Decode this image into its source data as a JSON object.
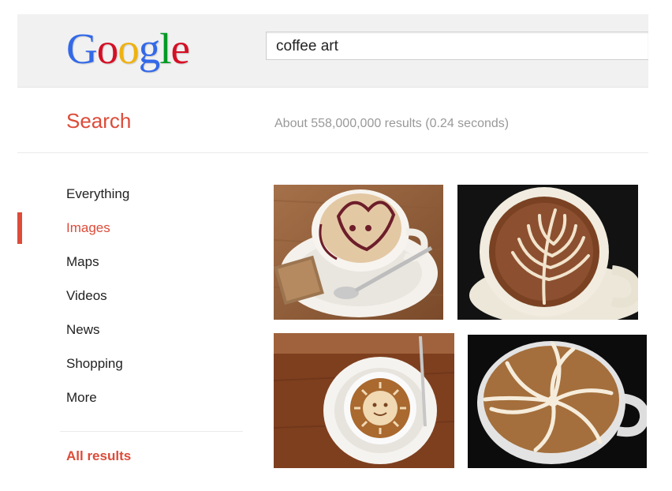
{
  "header": {
    "logo": "Google",
    "logo_colors": [
      "#3369e8",
      "#d50f25",
      "#eeb211",
      "#3369e8",
      "#009925",
      "#d50f25"
    ],
    "search_query": "coffee art"
  },
  "search_label": "Search",
  "result_stats": "About 558,000,000 results (0.24 seconds)",
  "nav": {
    "items": [
      {
        "label": "Everything",
        "active": false
      },
      {
        "label": "Images",
        "active": true
      },
      {
        "label": "Maps",
        "active": false
      },
      {
        "label": "Videos",
        "active": false
      },
      {
        "label": "News",
        "active": false
      },
      {
        "label": "Shopping",
        "active": false
      },
      {
        "label": "More",
        "active": false
      }
    ],
    "all_results": "All results",
    "accent_color": "#dd4b39"
  },
  "images": [
    {
      "icon": "latte-art-face-photo"
    },
    {
      "icon": "latte-art-rosetta-photo"
    },
    {
      "icon": "latte-art-sun-photo"
    },
    {
      "icon": "latte-art-swirl-photo"
    }
  ]
}
